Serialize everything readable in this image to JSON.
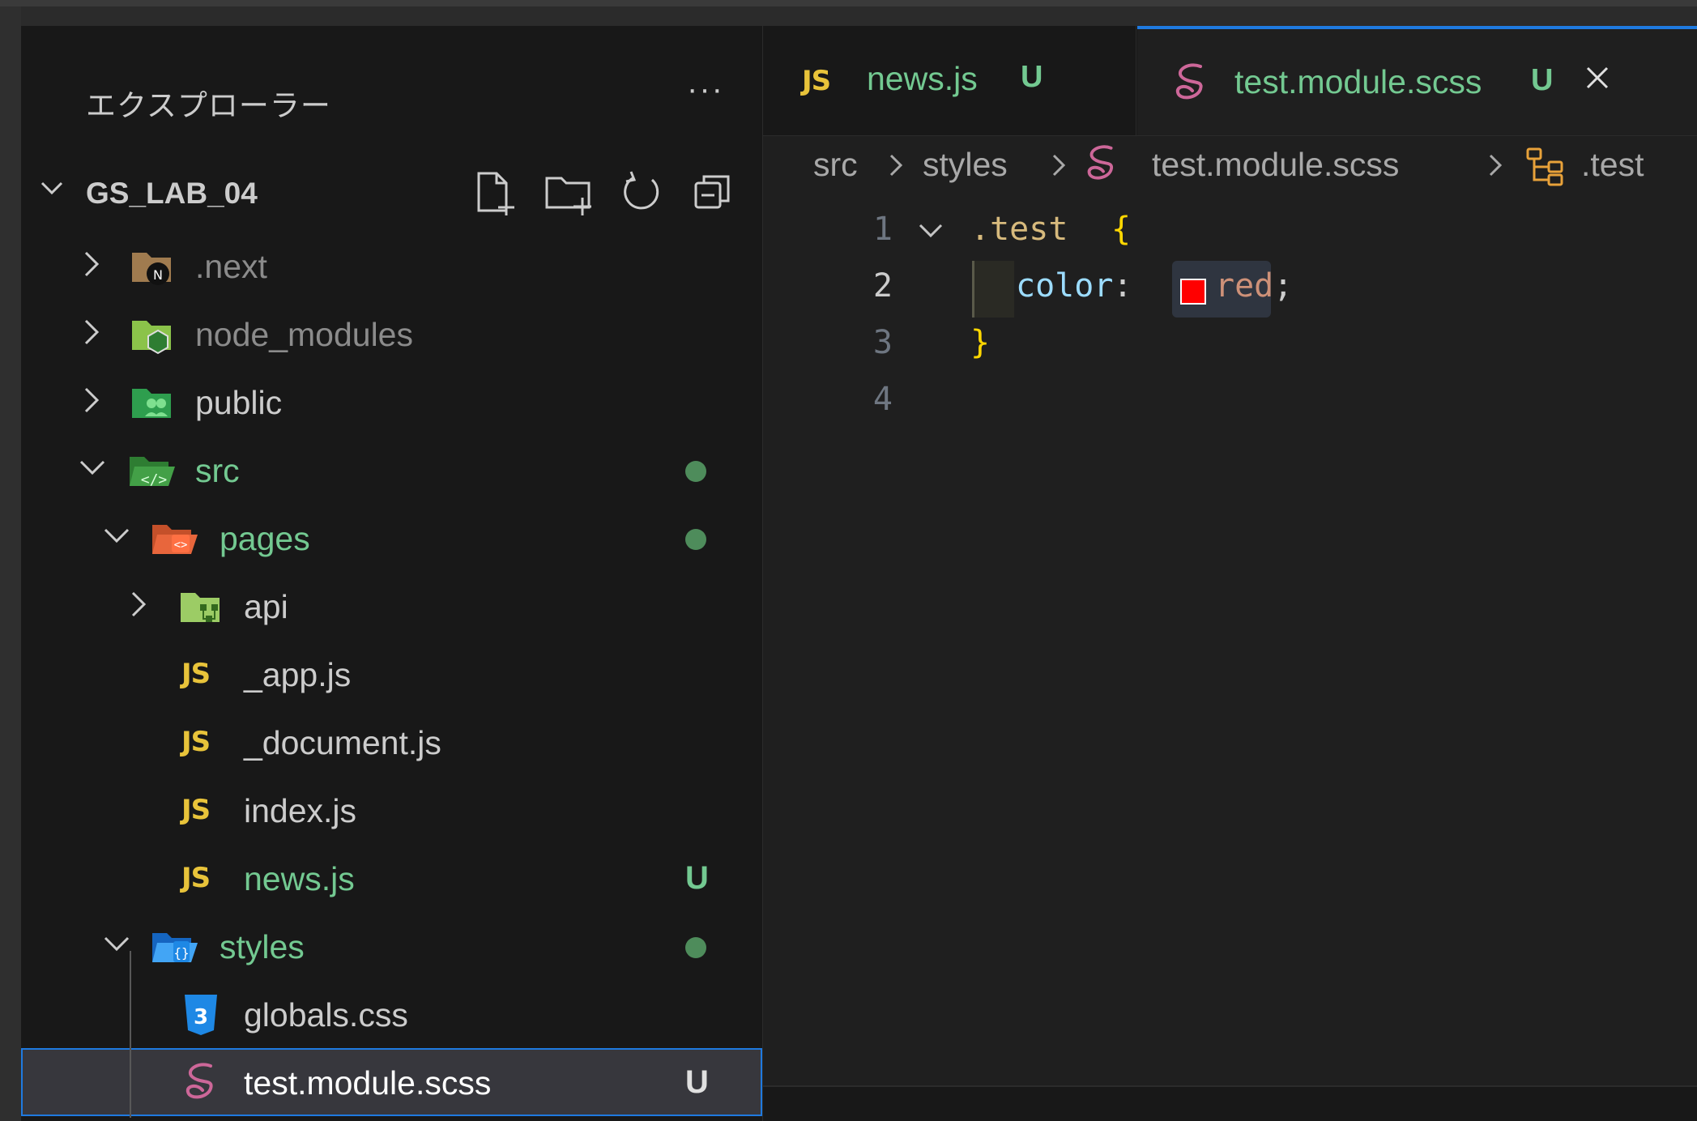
{
  "explorer": {
    "title": "エクスプローラー",
    "more": "···",
    "workspace": {
      "name": "GS_LAB_04"
    },
    "items": [
      {
        "label": ".next"
      },
      {
        "label": "node_modules"
      },
      {
        "label": "public"
      },
      {
        "label": "src"
      },
      {
        "label": "pages"
      },
      {
        "label": "api"
      },
      {
        "label": "_app.js",
        "icon_text": "JS"
      },
      {
        "label": "_document.js",
        "icon_text": "JS"
      },
      {
        "label": "index.js",
        "icon_text": "JS"
      },
      {
        "label": "news.js",
        "icon_text": "JS",
        "badge": "U"
      },
      {
        "label": "styles"
      },
      {
        "label": "globals.css"
      },
      {
        "label": "test.module.scss",
        "badge": "U"
      }
    ]
  },
  "tabs": [
    {
      "icon_text": "JS",
      "label": "news.js",
      "badge": "U"
    },
    {
      "label": "test.module.scss",
      "badge": "U"
    }
  ],
  "breadcrumb": [
    "src",
    "styles",
    "test.module.scss",
    ".test"
  ],
  "code": {
    "line_numbers": [
      "1",
      "2",
      "3",
      "4"
    ],
    "line1_selector": ".test",
    "line1_brace": "{",
    "line2_property": "color",
    "line2_colon": ":",
    "line2_value": "red",
    "line2_semicolon": ";",
    "line3_brace": "}"
  },
  "colors": {
    "accent": "#1f7ae0",
    "untracked": "#73c991",
    "scss_pink": "#cd6799",
    "js_yellow": "#e8c33a",
    "swatch": "#ff0000"
  }
}
